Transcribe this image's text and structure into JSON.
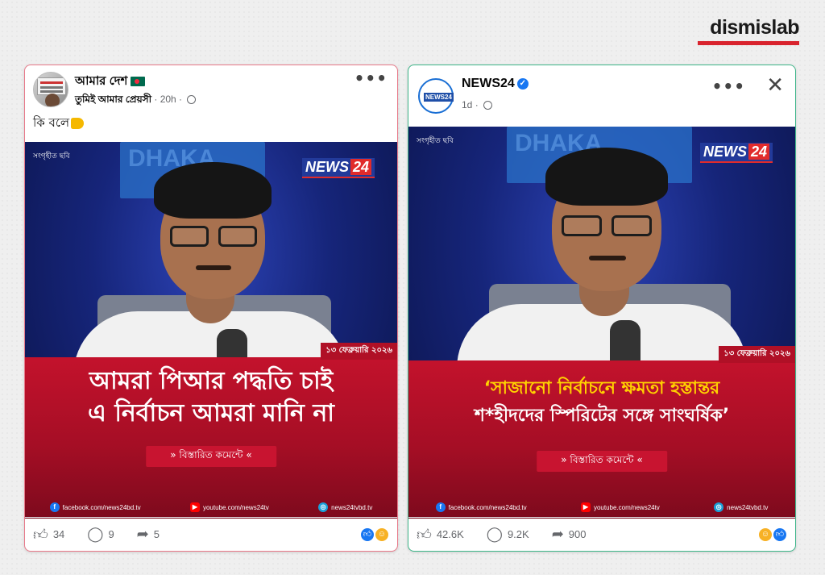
{
  "brand": {
    "name": "dismislab",
    "accent": "#d9242e"
  },
  "left_post": {
    "page_name": "আমার দেশ",
    "author": "তুমিই আমার প্রেয়সী",
    "time": "20h",
    "caption": "কি বলে",
    "image": {
      "collected_label": "সংগৃহীত ছবি",
      "logo_text": "NEWS",
      "logo_num": "24",
      "date": "১৩ ফেব্রুয়ারি ২০২৬",
      "headline_line1": "আমরা পিআর পদ্ধতি চাই",
      "headline_line2": "এ নির্বাচন আমরা মানি না",
      "detail_label": "»  বিস্তারিত কমেন্টে  «",
      "socials": [
        "facebook.com/news24bd.tv",
        "youtube.com/news24tv",
        "news24tvbd.tv"
      ]
    },
    "likes": "34",
    "comments": "9",
    "shares": "5"
  },
  "right_post": {
    "page_name": "NEWS24",
    "time": "1d",
    "image": {
      "collected_label": "সংগৃহীত ছবি",
      "logo_text": "NEWS",
      "logo_num": "24",
      "date": "১৩ ফেব্রুয়ারি ২০২৬",
      "headline_line1": "‘সাজানো নির্বাচনে ক্ষমতা হস্তান্তর",
      "headline_line2": "শ*হীদদের স্পিরিটের সঙ্গে সাংঘর্ষিক’",
      "detail_label": "»  বিস্তারিত কমেন্টে  «",
      "socials": [
        "facebook.com/news24bd.tv",
        "youtube.com/news24tv",
        "news24tvbd.tv"
      ]
    },
    "likes": "42.6K",
    "comments": "9.2K",
    "shares": "900"
  },
  "icons": [
    "more-dots-icon",
    "close-icon",
    "globe-icon",
    "verified-icon",
    "like-icon",
    "comment-icon",
    "share-icon"
  ]
}
